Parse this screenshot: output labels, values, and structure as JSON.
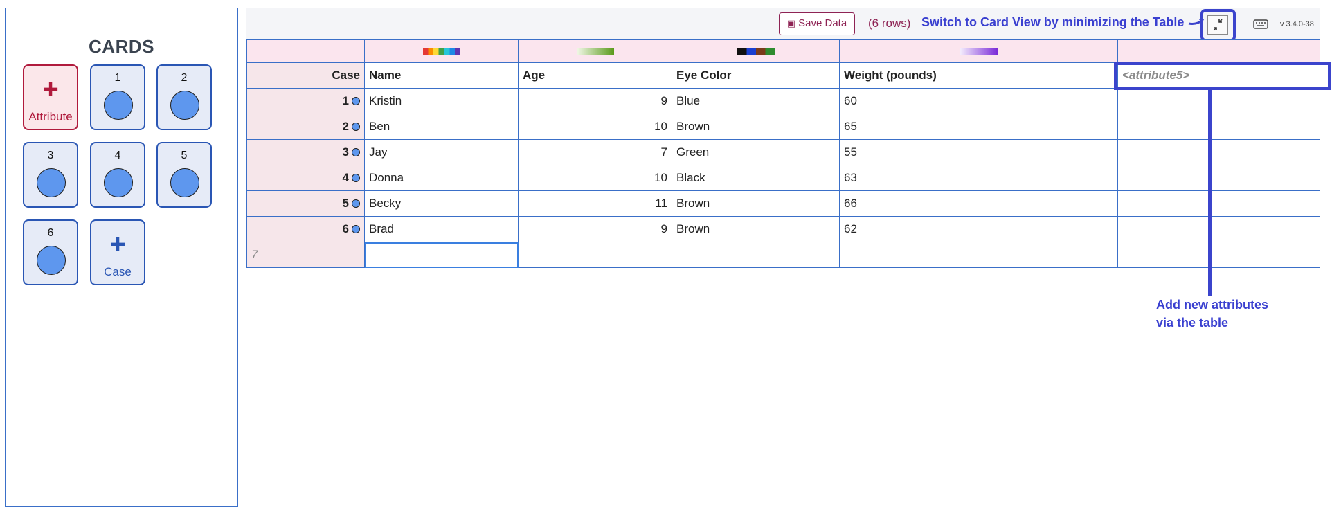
{
  "cards_panel": {
    "title": "CARDS",
    "add_attribute": {
      "icon": "plus-icon",
      "label": "Attribute"
    },
    "cases": [
      "1",
      "2",
      "3",
      "4",
      "5",
      "6"
    ],
    "add_case": {
      "icon": "plus-icon",
      "label": "Case"
    }
  },
  "toolbar": {
    "save_label": "Save Data",
    "save_icon": "disk-icon",
    "row_count": "(6 rows)",
    "minimize_icon": "minimize-arrows-icon",
    "keyboard_icon": "keyboard-icon",
    "version": "v 3.4.0-38"
  },
  "annotations": {
    "switch_view": "Switch to Card View by minimizing the Table",
    "add_attributes_line1": "Add new attributes",
    "add_attributes_line2": "via the table"
  },
  "table": {
    "headers": [
      "Case",
      "Name",
      "Age",
      "Eye Color",
      "Weight (pounds)",
      "<attribute5>"
    ],
    "rows": [
      {
        "case": "1",
        "name": "Kristin",
        "age": "9",
        "eye": "Blue",
        "weight": "60"
      },
      {
        "case": "2",
        "name": "Ben",
        "age": "10",
        "eye": "Brown",
        "weight": "65"
      },
      {
        "case": "3",
        "name": "Jay",
        "age": "7",
        "eye": "Green",
        "weight": "55"
      },
      {
        "case": "4",
        "name": "Donna",
        "age": "10",
        "eye": "Black",
        "weight": "63"
      },
      {
        "case": "5",
        "name": "Becky",
        "age": "11",
        "eye": "Brown",
        "weight": "66"
      },
      {
        "case": "6",
        "name": "Brad",
        "age": "9",
        "eye": "Brown",
        "weight": "62"
      }
    ],
    "new_row_number": "7"
  },
  "colors": {
    "accent_blue": "#3b44cc",
    "table_border": "#3a6fc8",
    "save_accent": "#8e2354",
    "attribute_red": "#b01a3c",
    "case_dot": "#5e97ee"
  }
}
